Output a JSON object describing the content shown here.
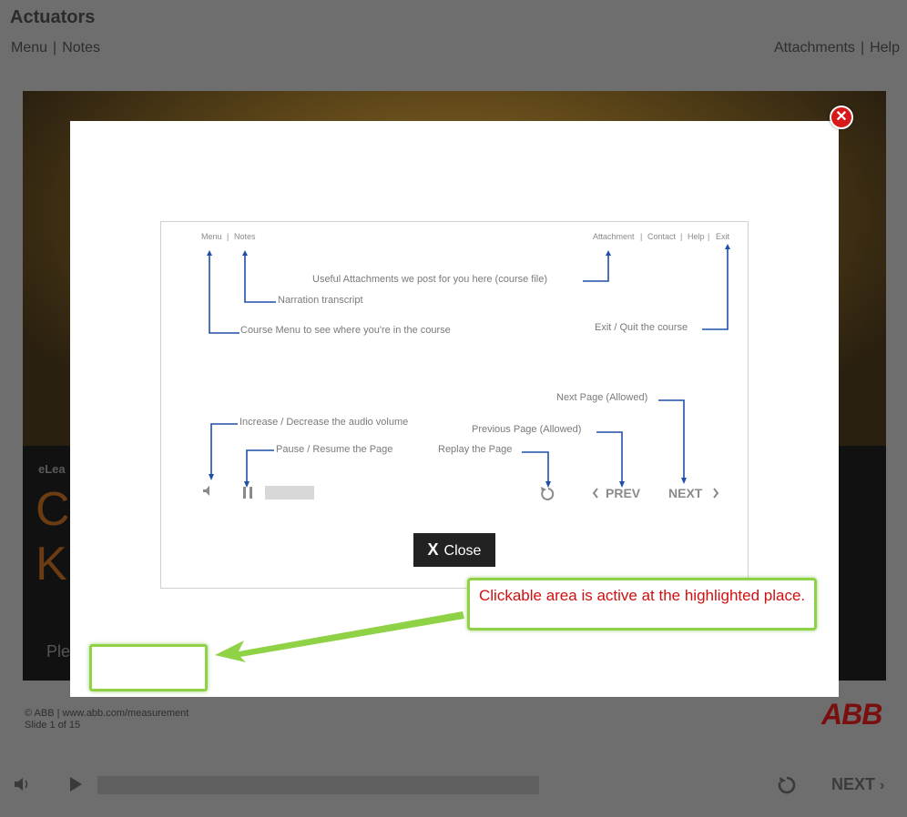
{
  "header": {
    "title": "Actuators",
    "menu_label": "Menu",
    "notes_label": "Notes",
    "attachments_label": "Attachments",
    "help_label": "Help",
    "separator": "|"
  },
  "slide": {
    "brand_text": "eLea",
    "big_text_line1": "C",
    "big_text_line2": "K",
    "please_text": "Ple"
  },
  "footer": {
    "copyright": "© ABB | www.abb.com/measurement",
    "slide_counter": "Slide 1 of 15",
    "logo_text": "ABB"
  },
  "player": {
    "next_label": "NEXT",
    "progress": 0
  },
  "modal": {
    "close_icon": "close-icon",
    "help_image": {
      "menu": "Menu",
      "notes": "Notes",
      "attachment": "Attachment",
      "contact": "Contact",
      "help": "Help",
      "exit": "Exit",
      "sep": "|",
      "ann_attachments": "Useful Attachments we post for you here (course file)",
      "ann_narration": "Narration transcript",
      "ann_course_menu": "Course Menu to see where you're in the course",
      "ann_exit": "Exit / Quit the course",
      "ann_next_page": "Next Page (Allowed)",
      "ann_volume": "Increase / Decrease the audio volume",
      "ann_prev_page": "Previous Page (Allowed)",
      "ann_pause": "Pause / Resume the Page",
      "ann_replay": "Replay the Page",
      "prev_label": "PREV",
      "next_label": "NEXT"
    },
    "close_button_icon": "X",
    "close_button_label": "Close",
    "callout_text": "Clickable area is active at the highlighted place."
  },
  "colors": {
    "accent_green": "#8fd246",
    "callout_red": "#d01010",
    "annotation_blue": "#1f4fa8",
    "close_red": "#d81919"
  }
}
